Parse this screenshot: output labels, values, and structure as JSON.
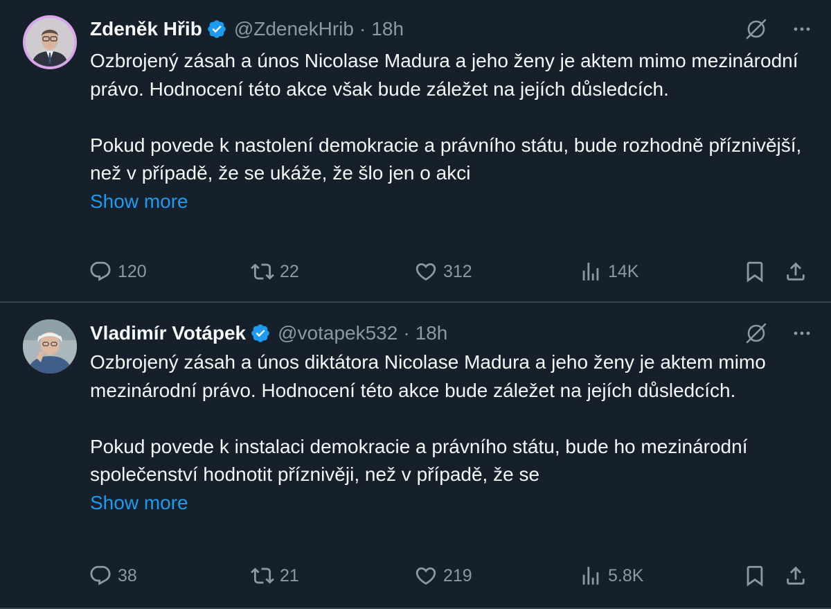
{
  "tweets": [
    {
      "author": {
        "name": "Zdeněk Hřib",
        "handle": "@ZdenekHrib",
        "verified": true
      },
      "time": "18h",
      "separator": "·",
      "paragraphs": [
        "Ozbrojený zásah a únos Nicolase Madura a jeho ženy je aktem mimo mezinárodní právo. Hodnocení této akce však bude záležet na jejích důsledcích.",
        "Pokud povede k nastolení demokracie a právního státu, bude rozhodně příznivější, než v případě, že se ukáže, že šlo jen o akci"
      ],
      "show_more": "Show more",
      "stats": {
        "replies": "120",
        "retweets": "22",
        "likes": "312",
        "views": "14K"
      }
    },
    {
      "author": {
        "name": "Vladimír Votápek",
        "handle": "@votapek532",
        "verified": true
      },
      "time": "18h",
      "separator": "·",
      "paragraphs": [
        "Ozbrojený zásah a únos diktátora Nicolase Madura a jeho ženy je aktem mimo mezinárodní právo. Hodnocení této akce bude záležet na jejích důsledcích.",
        "Pokud povede k instalaci demokracie a právního státu, bude ho mezinárodní společenství hodnotit příznivěji, než v případě, že se"
      ],
      "show_more": "Show more",
      "stats": {
        "replies": "38",
        "retweets": "21",
        "likes": "219",
        "views": "5.8K"
      }
    }
  ],
  "colors": {
    "background": "#15202b",
    "text_primary": "#f7f9f9",
    "text_secondary": "#8b98a5",
    "link": "#1d9bf0",
    "verified_badge": "#1d9bf0",
    "divider": "#38444d"
  },
  "icons": [
    "verified-badge-icon",
    "grok-icon",
    "more-icon",
    "reply-icon",
    "retweet-icon",
    "like-icon",
    "views-icon",
    "bookmark-icon",
    "share-icon"
  ]
}
